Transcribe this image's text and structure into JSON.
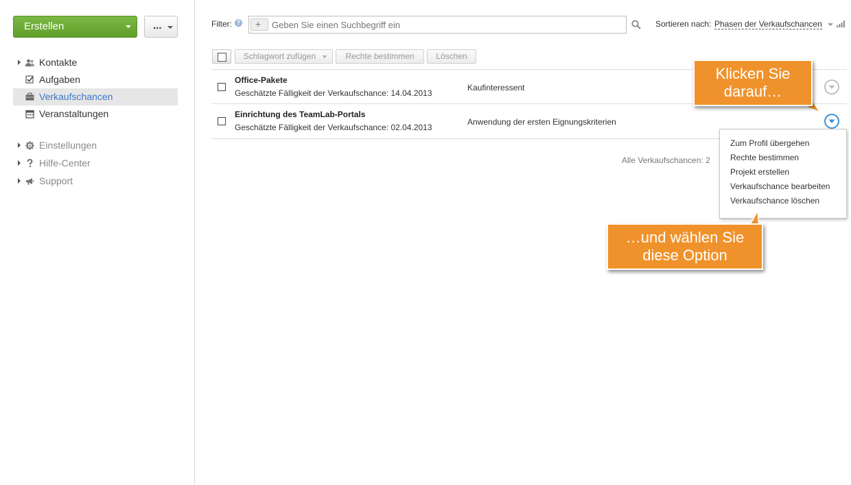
{
  "sidebar": {
    "create_label": "Erstellen",
    "more_label": "...",
    "nav": [
      {
        "label": "Kontakte",
        "icon": "contacts-icon",
        "expandable": true
      },
      {
        "label": "Aufgaben",
        "icon": "tasks-icon",
        "expandable": false
      },
      {
        "label": "Verkaufschancen",
        "icon": "briefcase-icon",
        "expandable": false,
        "active": true
      },
      {
        "label": "Veranstaltungen",
        "icon": "calendar-icon",
        "expandable": false
      }
    ],
    "nav2": [
      {
        "label": "Einstellungen",
        "icon": "gear-icon"
      },
      {
        "label": "Hilfe-Center",
        "icon": "question-icon"
      },
      {
        "label": "Support",
        "icon": "megaphone-icon"
      }
    ]
  },
  "filter": {
    "label": "Filter:",
    "placeholder": "Geben Sie einen Suchbegriff ein",
    "sort_label": "Sortieren nach:",
    "sort_value": "Phasen der Verkaufschancen"
  },
  "toolbar": {
    "tag_label": "Schlagwort zufügen",
    "rights_label": "Rechte bestimmen",
    "delete_label": "Löschen"
  },
  "rows": [
    {
      "title": "Office-Pakete",
      "due": "Geschätzte Fälligkeit der Verkaufschance: 14.04.2013",
      "stage": "Kaufinteressent"
    },
    {
      "title": "Einrichtung des TeamLab-Portals",
      "due": "Geschätzte Fälligkeit der Verkaufschance: 02.04.2013",
      "stage": "Anwendung der ersten Eignungskriterien"
    }
  ],
  "total": "Alle Verkaufschancen: 2",
  "dropdown": {
    "items": [
      "Zum Profil übergehen",
      "Rechte bestimmen",
      "Projekt erstellen",
      "Verkaufschance bearbeiten",
      "Verkaufschance löschen"
    ]
  },
  "callouts": {
    "top_line1": "Klicken Sie",
    "top_line2": "darauf…",
    "bottom_line1": "…und wählen Sie",
    "bottom_line2": "diese Option"
  },
  "colors": {
    "accent_green": "#6aab35",
    "link_blue": "#3b78c5",
    "callout_orange": "#f0922b"
  }
}
